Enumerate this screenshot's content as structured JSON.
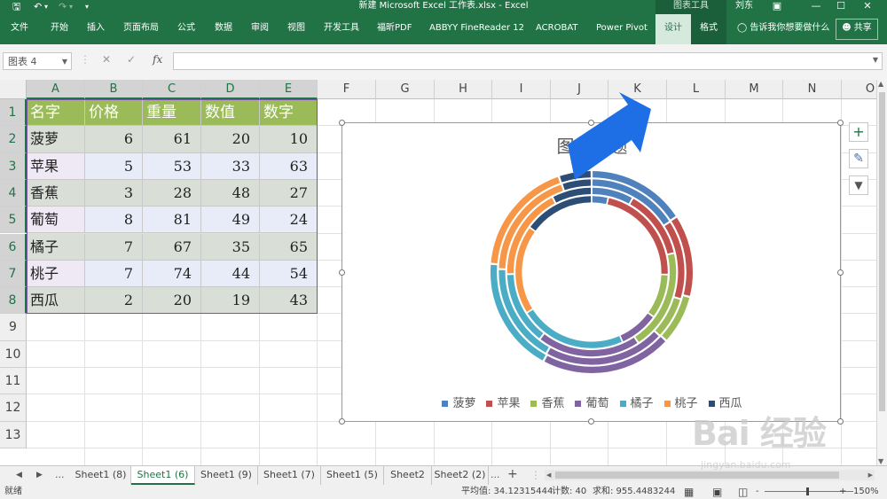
{
  "titlebar": {
    "title": "新建 Microsoft Excel 工作表.xlsx  -  Excel",
    "context_group": "图表工具",
    "user": "刘东",
    "save_icon": "save-icon",
    "undo_icon": "undo-icon",
    "redo_icon": "redo-icon",
    "customize_icon": "customize-quick-access-icon"
  },
  "ribbon": {
    "tabs": [
      "文件",
      "开始",
      "插入",
      "页面布局",
      "公式",
      "数据",
      "审阅",
      "视图",
      "开发工具",
      "福昕PDF",
      "ABBYY FineReader 12",
      "ACROBAT",
      "Power Pivot"
    ],
    "context_tabs": [
      "设计",
      "格式"
    ],
    "tell_me": "告诉我你想要做什么",
    "share": "共享"
  },
  "formula_bar": {
    "name_box": "图表 4",
    "cancel": "✕",
    "enter": "✓",
    "fx": "fx",
    "formula": ""
  },
  "grid": {
    "columns": [
      "A",
      "B",
      "C",
      "D",
      "E",
      "F",
      "G",
      "H",
      "I",
      "J",
      "K",
      "L",
      "M",
      "N",
      "O"
    ],
    "rows": [
      "1",
      "2",
      "3",
      "4",
      "5",
      "6",
      "7",
      "8",
      "9",
      "10",
      "11",
      "12",
      "13"
    ],
    "headers": [
      "名字",
      "价格",
      "重量",
      "数值",
      "数字"
    ],
    "data": [
      [
        "菠萝",
        "6",
        "61",
        "20",
        "10"
      ],
      [
        "苹果",
        "5",
        "53",
        "33",
        "63"
      ],
      [
        "香蕉",
        "3",
        "28",
        "48",
        "27"
      ],
      [
        "葡萄",
        "8",
        "81",
        "49",
        "24"
      ],
      [
        "橘子",
        "7",
        "67",
        "35",
        "65"
      ],
      [
        "桃子",
        "7",
        "74",
        "44",
        "54"
      ],
      [
        "西瓜",
        "2",
        "20",
        "19",
        "43"
      ]
    ]
  },
  "chart_data": {
    "type": "doughnut",
    "title": "图表标题",
    "categories": [
      "菠萝",
      "苹果",
      "香蕉",
      "葡萄",
      "橘子",
      "桃子",
      "西瓜"
    ],
    "series": [
      {
        "name": "价格",
        "values": [
          6,
          5,
          3,
          8,
          7,
          7,
          2
        ]
      },
      {
        "name": "重量",
        "values": [
          61,
          53,
          28,
          81,
          67,
          74,
          20
        ]
      },
      {
        "name": "数值",
        "values": [
          20,
          33,
          48,
          49,
          35,
          44,
          19
        ]
      },
      {
        "name": "数字",
        "values": [
          10,
          63,
          27,
          24,
          65,
          54,
          43
        ]
      }
    ],
    "colors": [
      "#4f81bd",
      "#c0504d",
      "#9bbb59",
      "#8064a2",
      "#4bacc6",
      "#f79646",
      "#2c4d75"
    ],
    "legend_position": "bottom"
  },
  "chart_buttons": [
    "chart-elements-icon",
    "chart-styles-icon",
    "chart-filters-icon"
  ],
  "sheet_tabs": {
    "tabs": [
      "Sheet1 (8)",
      "Sheet1 (6)",
      "Sheet1 (9)",
      "Sheet1 (7)",
      "Sheet1 (5)",
      "Sheet2",
      "Sheet2 (2)"
    ],
    "active": "Sheet1 (6)",
    "more": "...",
    "add": "+"
  },
  "status": {
    "mode": "就绪",
    "average": "平均值: 34.12315444",
    "count": "计数: 40",
    "sum": "求和: 955.4483244",
    "zoom": "150%",
    "zoom_minus": "-",
    "zoom_plus": "+"
  },
  "watermark": {
    "brand": "Bai 经验",
    "url": "jingyan.baidu.com"
  },
  "annotation_arrow_color": "#1e6fe6",
  "accent": "#217346"
}
